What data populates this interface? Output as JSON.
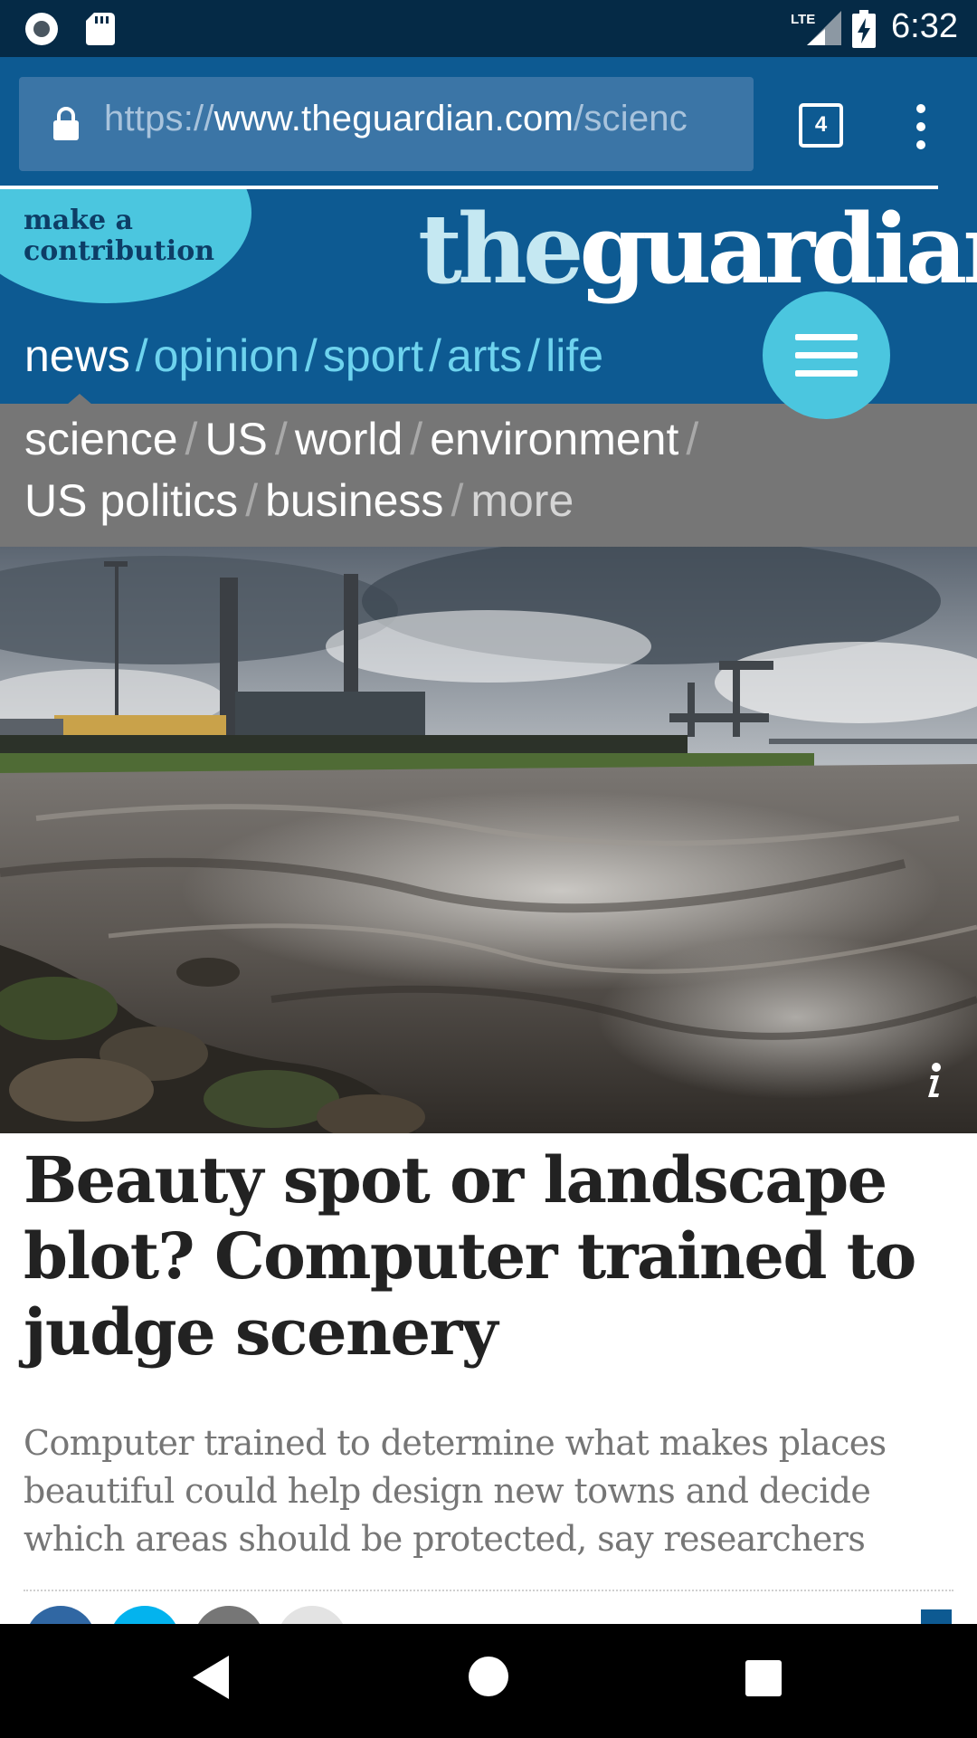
{
  "status_bar": {
    "time": "6:32",
    "network": "LTE",
    "icons": [
      "record-icon",
      "sd-card-icon",
      "lte-signal-icon",
      "battery-charging-icon"
    ]
  },
  "browser": {
    "url_scheme": "https://",
    "url_host": "www.theguardian.com",
    "url_path": "/scienc",
    "tab_count": "4",
    "icons": [
      "lock-icon",
      "tab-switcher-icon",
      "overflow-menu-icon"
    ]
  },
  "masthead": {
    "contribute_line1": "make a",
    "contribute_line2": "contribution",
    "logo_the": "the",
    "logo_guardian": "guardian",
    "pillars": [
      {
        "label": "news",
        "active": true
      },
      {
        "label": "opinion",
        "active": false
      },
      {
        "label": "sport",
        "active": false
      },
      {
        "label": "arts",
        "active": false
      },
      {
        "label": "life",
        "active": false
      }
    ],
    "separator": "/"
  },
  "subnav": {
    "items": [
      "science",
      "US",
      "world",
      "environment",
      "US politics",
      "business",
      "more"
    ]
  },
  "article": {
    "headline": "Beauty spot or landscape blot? Computer trained to judge scenery",
    "standfirst": "Computer trained to determine what makes places beautiful could help design new towns and decide which areas should be protected, say researchers",
    "hero_info": "i"
  },
  "colors": {
    "guardian_blue": "#0d5a92",
    "status_bar": "#052a46",
    "contribute": "#4bc6df",
    "pillar_text": "#6ed3ee",
    "subnav_bg": "#767676",
    "headline": "#222222",
    "standfirst": "#767676"
  }
}
